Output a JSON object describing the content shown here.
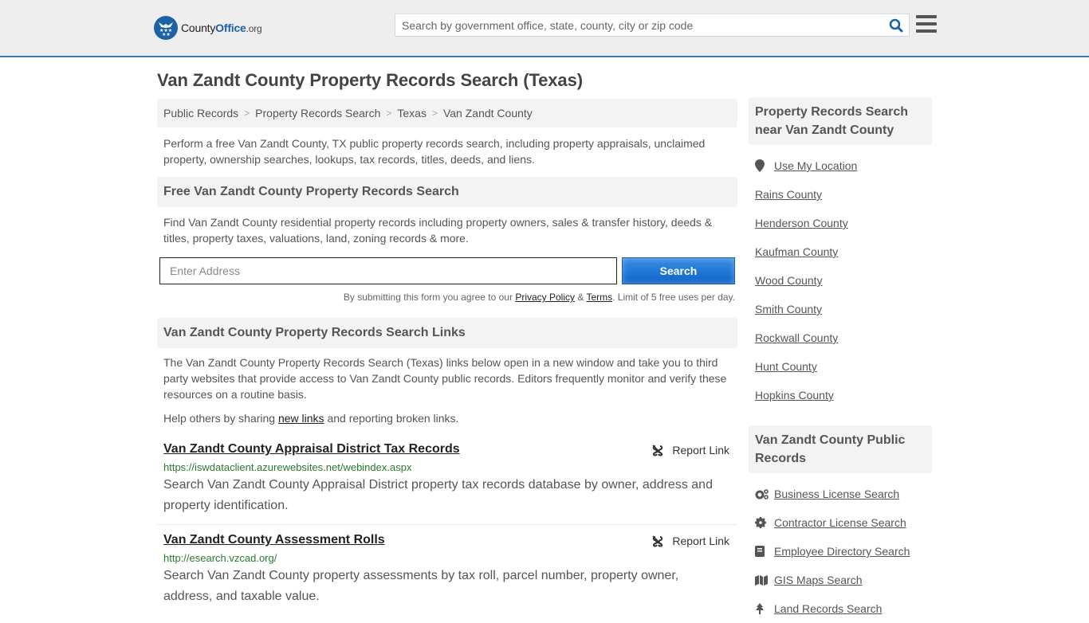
{
  "header": {
    "logo": {
      "name_pre": "County",
      "name_bold": "Office",
      "tld": ".org"
    },
    "search_placeholder": "Search by government office, state, county, city or zip code",
    "search_icon": "search-icon",
    "menu_icon": "hamburger-menu-icon",
    "accent_color": "#1d62a8",
    "border_color": "#3a7bab"
  },
  "page_title": "Van Zandt County Property Records Search (Texas)",
  "breadcrumb": [
    {
      "label": "Public Records"
    },
    {
      "label": "Property Records Search"
    },
    {
      "label": "Texas"
    },
    {
      "label": "Van Zandt County"
    }
  ],
  "intro": "Perform a free Van Zandt County, TX public property records search, including property appraisals, unclaimed property, ownership searches, lookups, tax records, titles, deeds, and liens.",
  "free_search": {
    "heading": "Free Van Zandt County Property Records Search",
    "description": "Find Van Zandt County residential property records including property owners, sales & transfer history, deeds & titles, property taxes, valuations, land, zoning records & more.",
    "address_placeholder": "Enter Address",
    "address_value": "",
    "button_label": "Search",
    "disclaimer_pre": "By submitting this form you agree to our ",
    "privacy_label": "Privacy Policy",
    "amp": " & ",
    "terms_label": "Terms",
    "disclaimer_post": ". Limit of 5 free uses per day."
  },
  "links_section": {
    "heading": "Van Zandt County Property Records Search Links",
    "description": "The Van Zandt County Property Records Search (Texas) links below open in a new window and take you to third party websites that provide access to Van Zandt County public records. Editors frequently monitor and verify these resources on a routine basis.",
    "help_pre": "Help others by sharing ",
    "help_link": "new links",
    "help_post": " and reporting broken links.",
    "report_label": "Report Link",
    "results": [
      {
        "title": "Van Zandt County Appraisal District Tax Records",
        "url": "https://iswdataclient.azurewebsites.net/webindex.aspx",
        "description": "Search Van Zandt County Appraisal District property tax records database by owner, address and property identification."
      },
      {
        "title": "Van Zandt County Assessment Rolls",
        "url": "http://esearch.vzcad.org/",
        "description": "Search Van Zandt County property assessments by tax roll, parcel number, property owner, address, and taxable value."
      }
    ]
  },
  "sidebar": {
    "nearby": {
      "heading": "Property Records Search near Van Zandt County",
      "use_location": "Use My Location",
      "items": [
        {
          "label": "Rains County"
        },
        {
          "label": "Henderson County"
        },
        {
          "label": "Kaufman County"
        },
        {
          "label": "Wood County"
        },
        {
          "label": "Smith County"
        },
        {
          "label": "Rockwall County"
        },
        {
          "label": "Hunt County"
        },
        {
          "label": "Hopkins County"
        }
      ]
    },
    "public_records": {
      "heading": "Van Zandt County Public Records",
      "items": [
        {
          "label": "Business License Search",
          "icon": "cogs-icon"
        },
        {
          "label": "Contractor License Search",
          "icon": "gear-icon"
        },
        {
          "label": "Employee Directory Search",
          "icon": "book-icon"
        },
        {
          "label": "GIS Maps Search",
          "icon": "map-icon"
        },
        {
          "label": "Land Records Search",
          "icon": "tree-icon"
        }
      ]
    }
  }
}
